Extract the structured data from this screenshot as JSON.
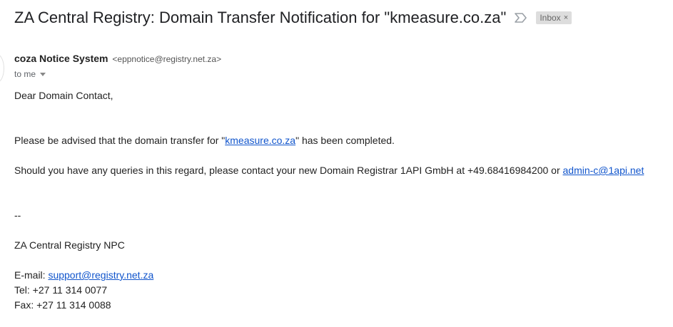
{
  "email": {
    "subject": "ZA Central Registry: Domain Transfer Notification for \"kmeasure.co.za\"",
    "label": "Inbox",
    "label_remove": "×",
    "sender_name": "coza Notice System",
    "sender_email": "<eppnotice@registry.net.za>",
    "recipient": "to me"
  },
  "body": {
    "greeting": "Dear Domain Contact,",
    "advised_prefix": "Please be advised that the domain transfer for \"",
    "domain_link": "kmeasure.co.za",
    "advised_suffix": "\" has been completed.",
    "queries_text": "Should you have any queries in this regard, please contact your new Domain Registrar 1API GmbH at +49.68416984200 or ",
    "registrar_email_link": "admin-c@1api.net",
    "separator": "--",
    "org_name": "ZA Central Registry NPC",
    "email_label": "E-mail: ",
    "support_email_link": "support@registry.net.za",
    "tel": "Tel: +27 11 314 0077",
    "fax": "Fax: +27 11 314 0088"
  },
  "icons": {
    "important": "importance-marker-icon",
    "expand": "chevron-down-icon"
  }
}
